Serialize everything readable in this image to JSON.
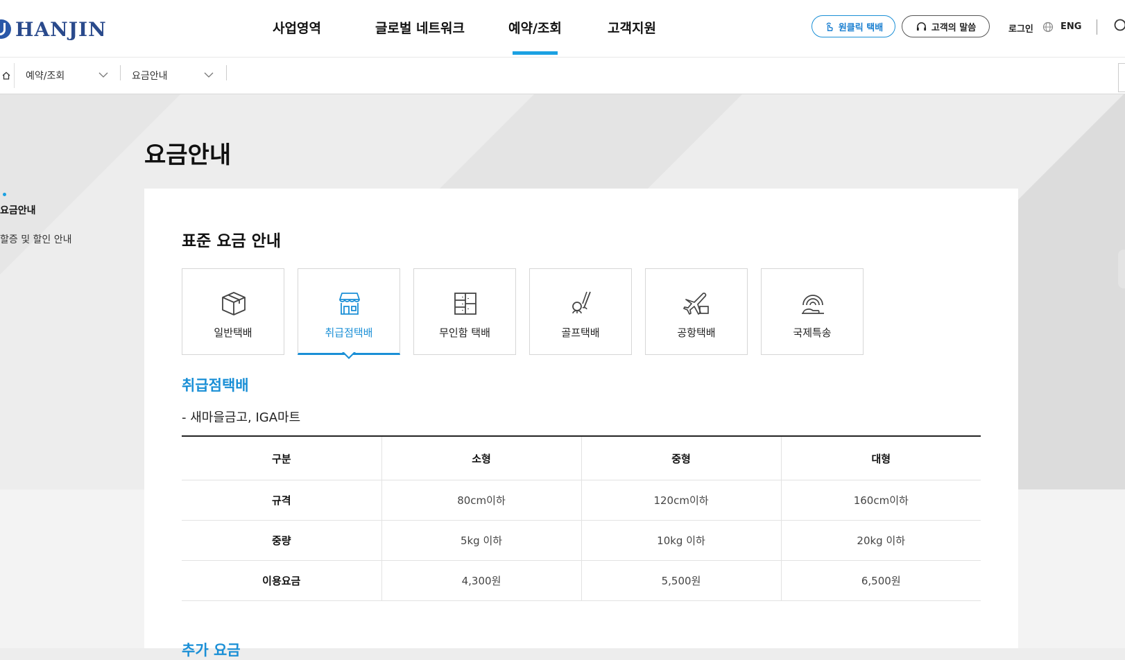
{
  "header": {
    "logo_text": "HANJIN",
    "nav": [
      {
        "label": "사업영역"
      },
      {
        "label": "글로벌 네트워크"
      },
      {
        "label": "예약/조회",
        "active": true
      },
      {
        "label": "고객지원"
      }
    ],
    "oneclick_label": "원클릭 택배",
    "voice_label": "고객의 말씀",
    "login_label": "로그인",
    "lang_label": "ENG"
  },
  "breadcrumb": {
    "items": [
      {
        "label": "예약/조회"
      },
      {
        "label": "요금안내"
      }
    ]
  },
  "side_menu": {
    "items": [
      {
        "label": "요금안내",
        "active": true
      },
      {
        "label": "할증 및 할인 안내",
        "active": false
      }
    ]
  },
  "page_title": "요금안내",
  "content": {
    "section_title": "표준 요금 안내",
    "tabs": [
      {
        "label": "일반택배",
        "icon": "box-icon"
      },
      {
        "label": "취급점택배",
        "icon": "store-icon",
        "active": true
      },
      {
        "label": "무인함 택배",
        "icon": "locker-icon"
      },
      {
        "label": "골프택배",
        "icon": "golf-icon"
      },
      {
        "label": "공항택배",
        "icon": "airplane-icon"
      },
      {
        "label": "국제특송",
        "icon": "globe-hand-icon"
      }
    ],
    "sub_title": "취급점택배",
    "sub_desc": "- 새마을금고, IGA마트",
    "table": {
      "headers": [
        "구분",
        "소형",
        "중형",
        "대형"
      ],
      "rows": [
        {
          "label": "규격",
          "cells": [
            "80cm이하",
            "120cm이하",
            "160cm이하"
          ]
        },
        {
          "label": "중량",
          "cells": [
            "5kg 이하",
            "10kg 이하",
            "20kg 이하"
          ]
        },
        {
          "label": "이용요금",
          "cells": [
            "4,300원",
            "5,500원",
            "6,500원"
          ]
        }
      ]
    },
    "next_title": "추가 요금"
  },
  "colors": {
    "accent": "#1a8fd6",
    "nav_underline": "#1ba1e2",
    "logo": "#2a4a8c"
  }
}
